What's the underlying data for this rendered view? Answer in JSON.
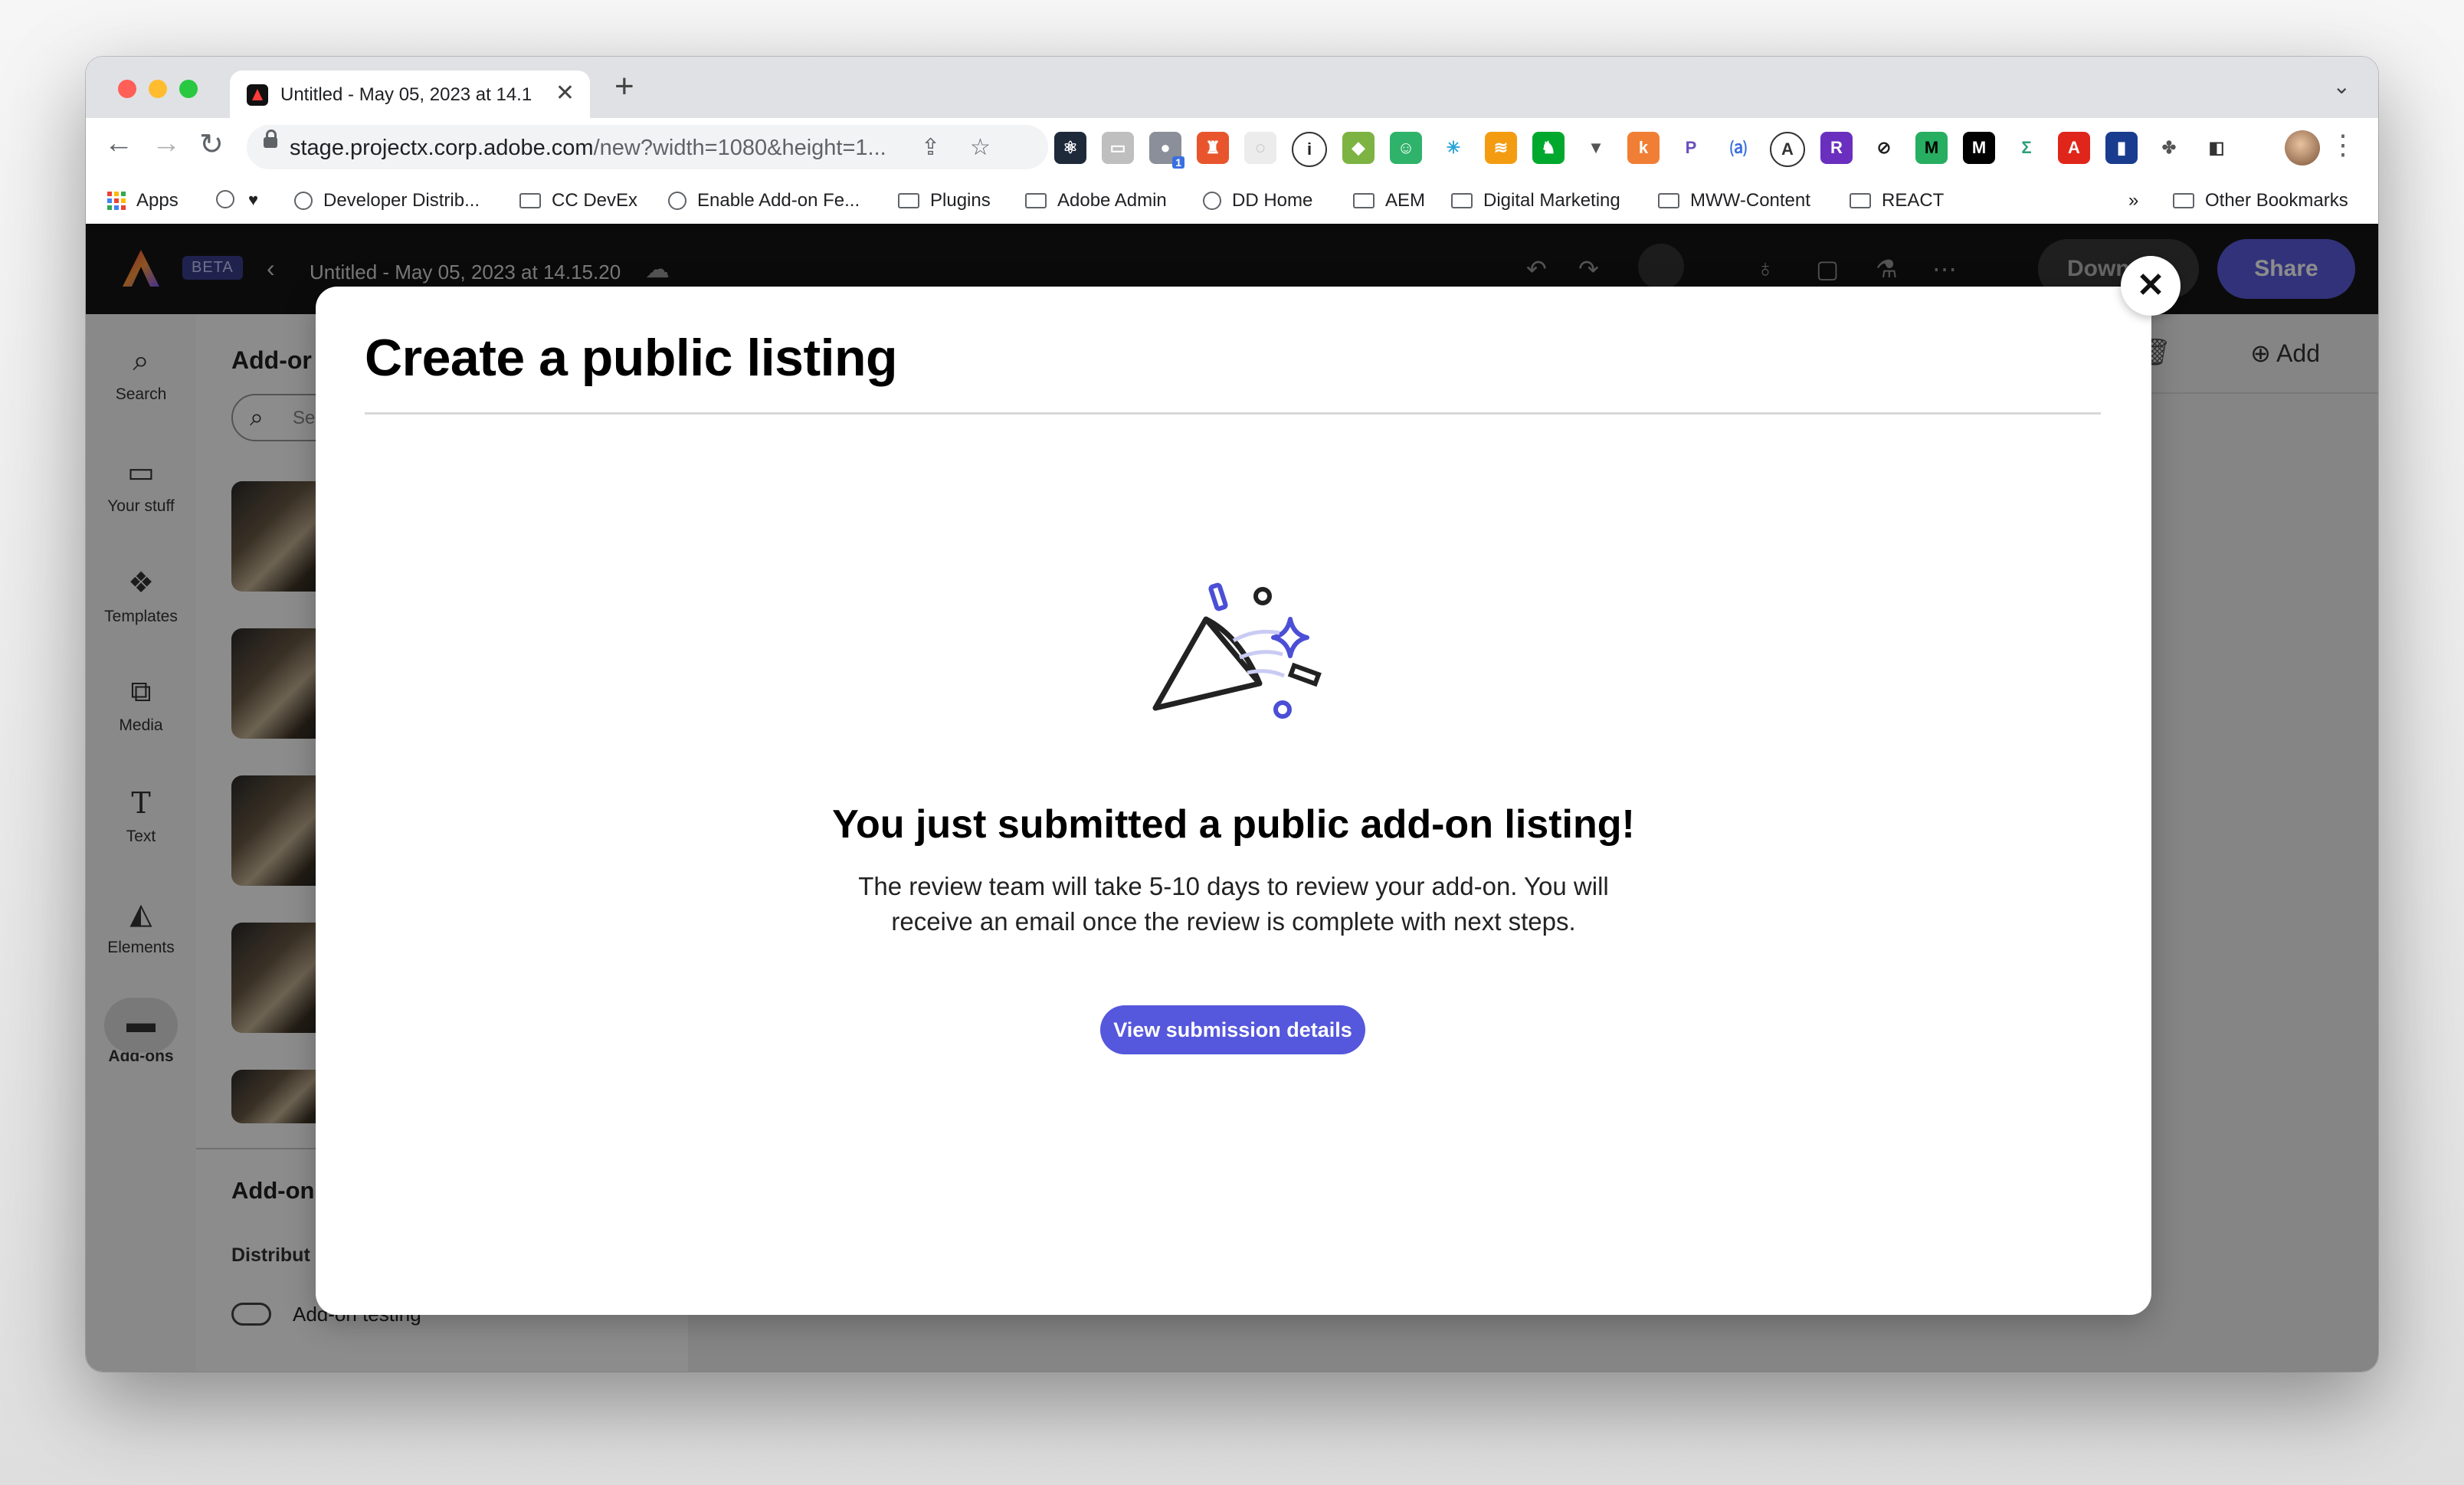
{
  "browser": {
    "tab_title": "Untitled - May 05, 2023 at 14.1",
    "tab_close": "✕",
    "new_tab": "+",
    "url_host": "stage.projectx.corp.adobe.com",
    "url_path": "/new?width=1080&height=1...",
    "bookmarks": {
      "apps": "Apps",
      "developer": "Developer Distrib...",
      "cc_devex": "CC DevEx",
      "enable_addon": "Enable Add-on Fe...",
      "plugins": "Plugins",
      "adobe_admin": "Adobe Admin",
      "dd_home": "DD Home",
      "aem": "AEM",
      "digital_marketing": "Digital Marketing",
      "mww_content": "MWW-Content",
      "react": "REACT",
      "more": "»",
      "other": "Other Bookmarks"
    },
    "extension_badge": "1"
  },
  "app": {
    "beta_label": "BETA",
    "doc_title": "Untitled - May 05, 2023 at 14.15.20",
    "download_label": "Down",
    "share_label": "Share",
    "add_label": "Add",
    "rail": {
      "search": "Search",
      "your_stuff": "Your stuff",
      "templates": "Templates",
      "media": "Media",
      "text": "Text",
      "elements": "Elements",
      "addons": "Add-ons"
    },
    "panel": {
      "title": "Add-or",
      "search_placeholder": "Se",
      "section_title": "Add-on",
      "distribute_label": "Distribut",
      "toggle_label": "Add-on testing"
    }
  },
  "modal": {
    "title": "Create a public listing",
    "heading": "You just submitted a public add-on listing!",
    "body_line1": "The review team will take 5-10 days to review your add-on. You will",
    "body_line2": "receive an email once the review is complete with next steps.",
    "cta_label": "View submission details",
    "close_label": "✕"
  },
  "colors": {
    "accent": "#5557dc",
    "share": "#5c5ce0",
    "app_header": "#141414"
  }
}
